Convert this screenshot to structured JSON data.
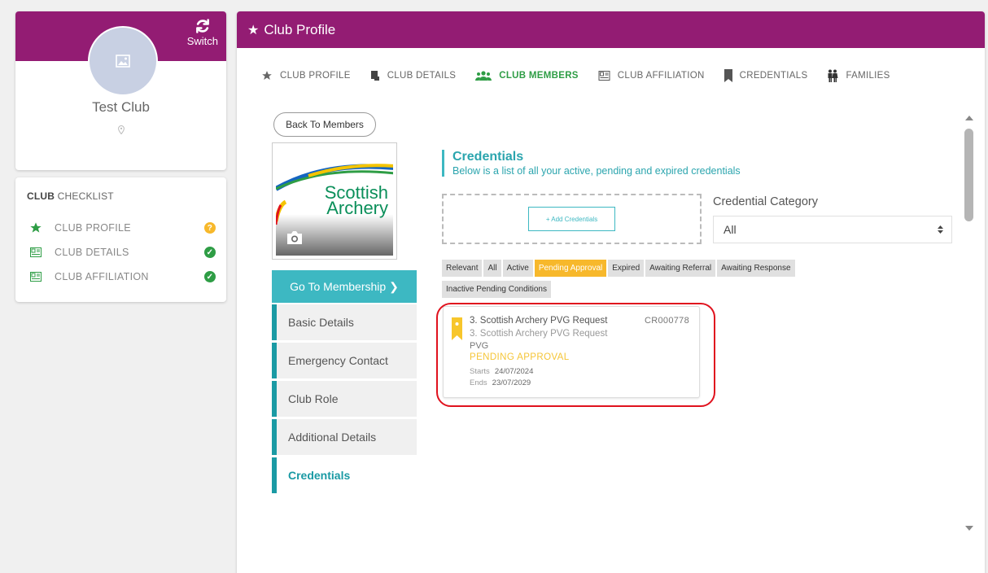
{
  "sidebar": {
    "switch_label": "Switch",
    "club_name": "Test Club",
    "checklist": {
      "title_bold": "CLUB",
      "title_rest": " CHECKLIST",
      "items": [
        {
          "label": "CLUB PROFILE",
          "status": "pending"
        },
        {
          "label": "CLUB DETAILS",
          "status": "complete"
        },
        {
          "label": "CLUB AFFILIATION",
          "status": "complete"
        }
      ]
    }
  },
  "header": {
    "title": "Club Profile"
  },
  "tabs": [
    {
      "label": "CLUB PROFILE",
      "icon": "star-icon"
    },
    {
      "label": "CLUB DETAILS",
      "icon": "document-icon"
    },
    {
      "label": "CLUB MEMBERS",
      "icon": "members-icon",
      "active": true
    },
    {
      "label": "CLUB AFFILIATION",
      "icon": "id-card-icon"
    },
    {
      "label": "CREDENTIALS",
      "icon": "bookmark-icon"
    },
    {
      "label": "FAMILIES",
      "icon": "family-icon"
    }
  ],
  "member": {
    "back_label": "Back To Members",
    "logo_line1": "Scottish",
    "logo_line2": "Archery",
    "go_membership_label": "Go To Membership ❯",
    "nav": [
      "Basic Details",
      "Emergency Contact",
      "Club Role",
      "Additional Details",
      "Credentials"
    ]
  },
  "credentials": {
    "title": "Credentials",
    "subtitle": "Below is a list of all your active, pending and expired credentials",
    "add_label": "+ Add Credentials",
    "category_label": "Credential Category",
    "category_value": "All",
    "filters": [
      "Relevant",
      "All",
      "Active",
      "Pending Approval",
      "Expired",
      "Awaiting Referral",
      "Awaiting Response",
      "Inactive Pending Conditions"
    ],
    "active_filter": "Pending Approval",
    "card": {
      "title": "3. Scottish Archery PVG Request",
      "code": "CR000778",
      "subtitle": "3. Scottish Archery PVG Request",
      "type": "PVG",
      "status": "PENDING APPROVAL",
      "starts_label": "Starts",
      "starts": "24/07/2024",
      "ends_label": "Ends",
      "ends": "23/07/2029"
    }
  },
  "colors": {
    "brand": "#931c73",
    "accent": "#3db8c2",
    "active_tab": "#2e9d45",
    "pending": "#f7b82b",
    "complete": "#2e9d45",
    "highlight": "#e0121e"
  }
}
